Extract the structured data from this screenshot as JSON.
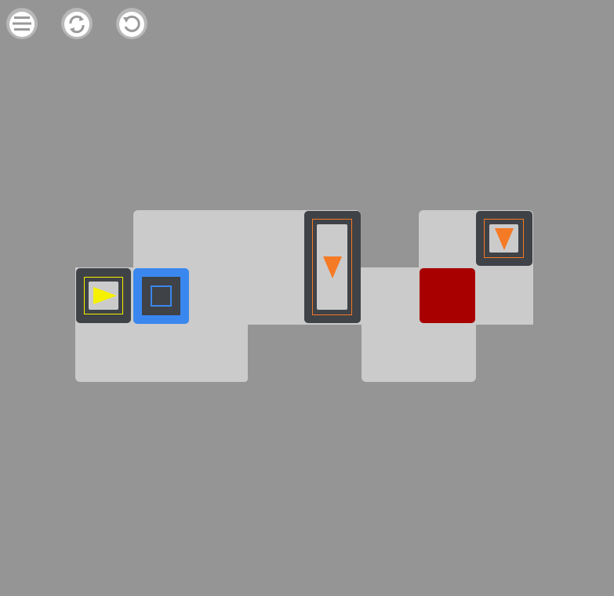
{
  "toolbar": {
    "menu_icon": "menu-icon",
    "shuffle_icon": "shuffle-icon",
    "restart_icon": "restart-icon"
  },
  "colors": {
    "background": "#959595",
    "floor": "#cbcbcb",
    "block": "#3f4246",
    "player_arrow": "#f6f100",
    "orange_arrow": "#f57a25",
    "blue_block": "#3a87f0",
    "goal_red": "#a80000",
    "button": "#b5b5b5"
  },
  "pieces": {
    "player": {
      "icon": "arrow-right-icon",
      "color": "yellow"
    },
    "blue_box": {
      "icon": "square-outline-icon",
      "color": "blue"
    },
    "tall_block": {
      "icon": "arrow-down-icon",
      "color": "orange"
    },
    "red_goal": {
      "color": "red"
    },
    "small_block": {
      "icon": "arrow-down-icon",
      "color": "orange"
    }
  }
}
